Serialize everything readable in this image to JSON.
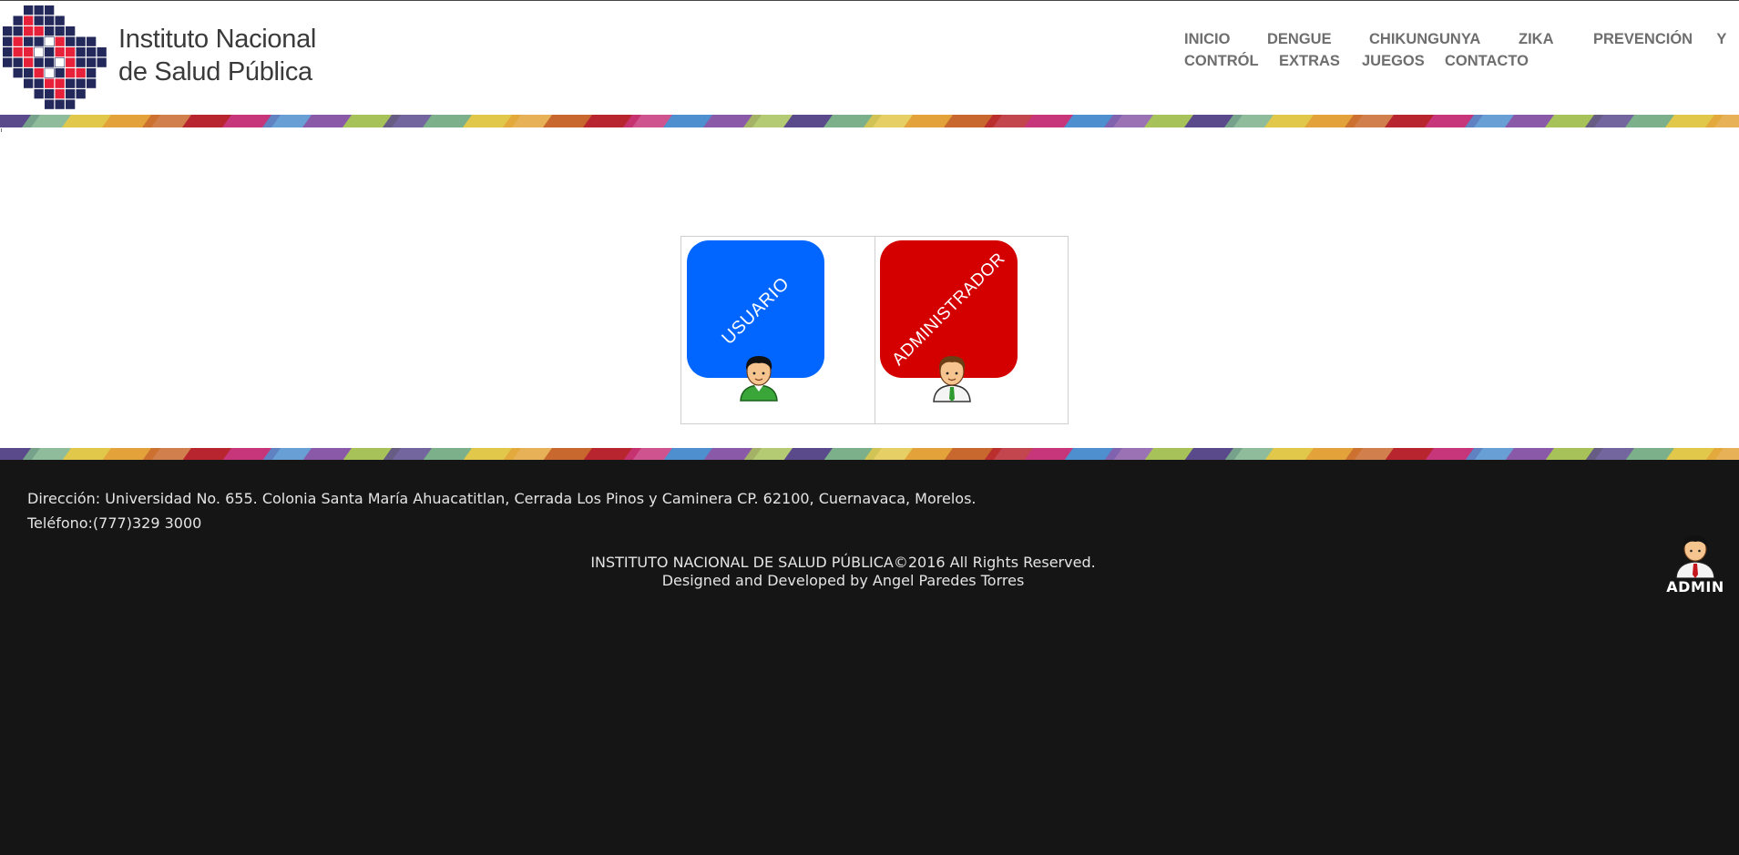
{
  "brand": {
    "line1": "Instituto Nacional",
    "line2": "de Salud Pública"
  },
  "nav": {
    "items": [
      {
        "label": "INICIO"
      },
      {
        "label": "DENGUE"
      },
      {
        "label": "CHIKUNGUNYA"
      },
      {
        "label": "ZIKA"
      },
      {
        "label": "PREVENCIÓN Y"
      },
      {
        "label": "CONTRÓL"
      },
      {
        "label": "EXTRAS"
      },
      {
        "label": "JUEGOS"
      },
      {
        "label": "CONTACTO"
      }
    ]
  },
  "roles": {
    "user": {
      "label": "USUARIO",
      "color": "#0066ff",
      "icon": "user-avatar-icon"
    },
    "admin": {
      "label": "ADMINISTRADOR",
      "color": "#d40000",
      "icon": "admin-avatar-icon"
    }
  },
  "footer": {
    "address": "Dirección: Universidad No. 655. Colonia Santa María Ahuacatitlan, Cerrada Los Pinos y Caminera CP. 62100, Cuernavaca, Morelos.",
    "phone": "Teléfono:(777)329 3000",
    "copyright": "INSTITUTO NACIONAL DE SALUD PÚBLICA©2016 All Rights Reserved.",
    "credits": "Designed and Developed by Angel Paredes Torres",
    "admin_label": "ADMIN"
  },
  "colors": {
    "footer_bg": "#151515",
    "nav_text": "#6e6e6e",
    "logo_navy": "#24295c",
    "logo_red": "#e8213a"
  }
}
